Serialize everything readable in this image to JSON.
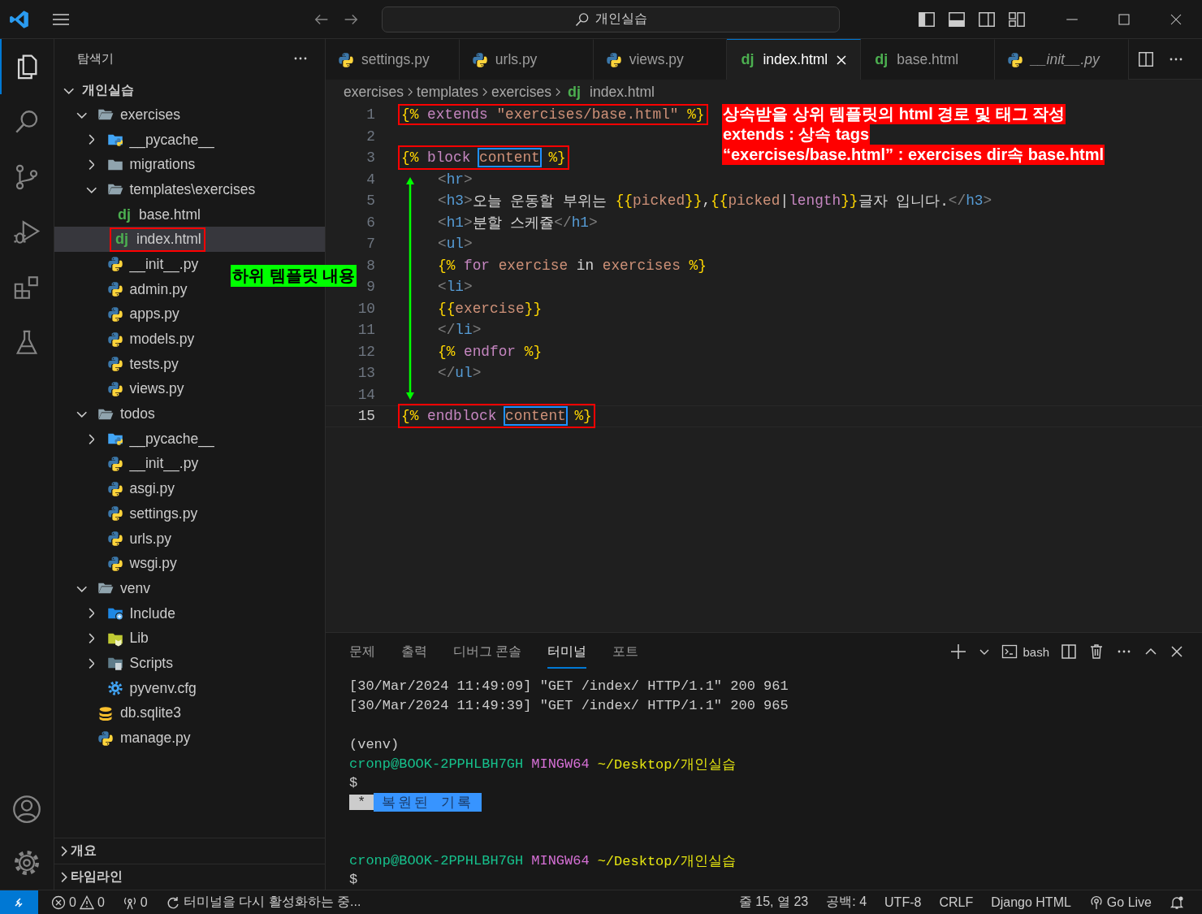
{
  "window": {
    "command_center": "개인실습"
  },
  "activity_bar": {
    "items": [
      {
        "kind": "explorer",
        "selected": true
      },
      {
        "kind": "search",
        "selected": false
      },
      {
        "kind": "source-control",
        "selected": false
      },
      {
        "kind": "run-debug",
        "selected": false
      },
      {
        "kind": "extensions",
        "selected": false
      },
      {
        "kind": "testing",
        "selected": false
      }
    ],
    "bottom": [
      {
        "kind": "account"
      },
      {
        "kind": "settings"
      }
    ]
  },
  "explorer": {
    "title": "탐색기",
    "root": {
      "label": "개인실습",
      "expanded": true,
      "children": [
        {
          "label": "exercises",
          "kind": "folder",
          "expanded": true,
          "selected": false,
          "children": [
            {
              "label": "__pycache__",
              "kind": "pycache",
              "expanded": false,
              "selected": false
            },
            {
              "label": "migrations",
              "kind": "folder",
              "expanded": false,
              "selected": false
            },
            {
              "label": "templates\\exercises",
              "kind": "folder",
              "expanded": true,
              "selected": false,
              "children": [
                {
                  "label": "base.html",
                  "kind": "django",
                  "icon_text": "dj",
                  "selected": false
                },
                {
                  "label": "index.html",
                  "kind": "django",
                  "icon_text": "dj",
                  "selected": true,
                  "boxed": true
                }
              ]
            },
            {
              "label": "__init__.py",
              "kind": "python",
              "selected": false
            },
            {
              "label": "admin.py",
              "kind": "python",
              "selected": false
            },
            {
              "label": "apps.py",
              "kind": "python",
              "selected": false
            },
            {
              "label": "models.py",
              "kind": "python",
              "selected": false
            },
            {
              "label": "tests.py",
              "kind": "python",
              "selected": false
            },
            {
              "label": "views.py",
              "kind": "python",
              "selected": false
            }
          ]
        },
        {
          "label": "todos",
          "kind": "folder",
          "expanded": true,
          "selected": false,
          "children": [
            {
              "label": "__pycache__",
              "kind": "pycache",
              "expanded": false,
              "selected": false
            },
            {
              "label": "__init__.py",
              "kind": "python",
              "selected": false
            },
            {
              "label": "asgi.py",
              "kind": "python",
              "selected": false
            },
            {
              "label": "settings.py",
              "kind": "python",
              "selected": false
            },
            {
              "label": "urls.py",
              "kind": "python",
              "selected": false
            },
            {
              "label": "wsgi.py",
              "kind": "python",
              "selected": false
            }
          ]
        },
        {
          "label": "venv",
          "kind": "folder",
          "expanded": true,
          "selected": false,
          "children": [
            {
              "label": "Include",
              "kind": "include",
              "expanded": false,
              "selected": false
            },
            {
              "label": "Lib",
              "kind": "lib",
              "expanded": false,
              "selected": false
            },
            {
              "label": "Scripts",
              "kind": "scripts",
              "expanded": false,
              "selected": false
            },
            {
              "label": "pyvenv.cfg",
              "kind": "config",
              "selected": false
            }
          ]
        },
        {
          "label": "db.sqlite3",
          "kind": "database",
          "selected": false
        },
        {
          "label": "manage.py",
          "kind": "python",
          "selected": false
        }
      ]
    },
    "sections": [
      {
        "label": "개요",
        "expanded": false
      },
      {
        "label": "타임라인",
        "expanded": false
      }
    ]
  },
  "editor": {
    "tabs": [
      {
        "label": "settings.py",
        "kind": "python",
        "selected": false,
        "preview": false
      },
      {
        "label": "urls.py",
        "kind": "python",
        "selected": false,
        "preview": false
      },
      {
        "label": "views.py",
        "kind": "python",
        "selected": false,
        "preview": false
      },
      {
        "label": "index.html",
        "kind": "django",
        "icon_text": "dj",
        "selected": true,
        "preview": false
      },
      {
        "label": "base.html",
        "kind": "django",
        "icon_text": "dj",
        "selected": false,
        "preview": false
      },
      {
        "label": "__init__.py",
        "kind": "python",
        "selected": false,
        "preview": true
      }
    ],
    "breadcrumb": [
      {
        "label": "exercises"
      },
      {
        "label": "templates"
      },
      {
        "label": "exercises"
      },
      {
        "label": "index.html",
        "icon_text": "dj"
      }
    ],
    "lines": [
      {
        "number": "1",
        "indented": false,
        "annotated": true,
        "active": false,
        "tokens": [
          {
            "text": "{%",
            "kind": "brace"
          },
          {
            "text": " extends ",
            "kind": "keyword"
          },
          {
            "text": "\"exercises/base.html\"",
            "kind": "string"
          },
          {
            "text": " %}",
            "kind": "brace"
          }
        ]
      },
      {
        "number": "2",
        "active": false
      },
      {
        "number": "3",
        "indented": false,
        "annotated": true,
        "active": false,
        "tokens": [
          {
            "text": "{%",
            "kind": "brace"
          },
          {
            "text": " block ",
            "kind": "keyword"
          },
          {
            "text": "content",
            "kind": "boxed"
          },
          {
            "text": " %}",
            "kind": "brace"
          }
        ]
      },
      {
        "number": "4",
        "indented": true,
        "annotated": false,
        "active": false,
        "tokens": [
          {
            "text": "<",
            "kind": "tag"
          },
          {
            "text": "hr",
            "kind": "tagname"
          },
          {
            "text": ">",
            "kind": "tag"
          }
        ]
      },
      {
        "number": "5",
        "indented": true,
        "annotated": false,
        "active": false,
        "tokens": [
          {
            "text": "<",
            "kind": "tag"
          },
          {
            "text": "h3",
            "kind": "tagname"
          },
          {
            "text": ">",
            "kind": "tag"
          },
          {
            "text": "오늘 운동할 부위는 ",
            "kind": "text"
          },
          {
            "text": "{{",
            "kind": "brace"
          },
          {
            "text": "picked",
            "kind": "var"
          },
          {
            "text": "}}",
            "kind": "brace"
          },
          {
            "text": ",",
            "kind": "text"
          },
          {
            "text": "{{",
            "kind": "brace"
          },
          {
            "text": "picked",
            "kind": "var"
          },
          {
            "text": "|",
            "kind": "text"
          },
          {
            "text": "length",
            "kind": "keyword"
          },
          {
            "text": "}}",
            "kind": "brace"
          },
          {
            "text": "글자 입니다.",
            "kind": "text"
          },
          {
            "text": "</",
            "kind": "tag"
          },
          {
            "text": "h3",
            "kind": "tagname"
          },
          {
            "text": ">",
            "kind": "tag"
          }
        ]
      },
      {
        "number": "6",
        "indented": true,
        "annotated": false,
        "active": false,
        "tokens": [
          {
            "text": "<",
            "kind": "tag"
          },
          {
            "text": "h1",
            "kind": "tagname"
          },
          {
            "text": ">",
            "kind": "tag"
          },
          {
            "text": "분할 스케쥴",
            "kind": "text"
          },
          {
            "text": "</",
            "kind": "tag"
          },
          {
            "text": "h1",
            "kind": "tagname"
          },
          {
            "text": ">",
            "kind": "tag"
          }
        ]
      },
      {
        "number": "7",
        "indented": true,
        "annotated": false,
        "active": false,
        "tokens": [
          {
            "text": "<",
            "kind": "tag"
          },
          {
            "text": "ul",
            "kind": "tagname"
          },
          {
            "text": ">",
            "kind": "tag"
          }
        ]
      },
      {
        "number": "8",
        "indented": true,
        "annotated": false,
        "active": false,
        "tokens": [
          {
            "text": "{%",
            "kind": "brace"
          },
          {
            "text": " for ",
            "kind": "keyword"
          },
          {
            "text": "exercise",
            "kind": "var"
          },
          {
            "text": " in ",
            "kind": "text"
          },
          {
            "text": "exercises",
            "kind": "var"
          },
          {
            "text": " %}",
            "kind": "brace"
          }
        ]
      },
      {
        "number": "9",
        "indented": true,
        "annotated": false,
        "active": false,
        "tokens": [
          {
            "text": "<",
            "kind": "tag"
          },
          {
            "text": "li",
            "kind": "tagname"
          },
          {
            "text": ">",
            "kind": "tag"
          }
        ]
      },
      {
        "number": "10",
        "indented": true,
        "annotated": false,
        "active": false,
        "tokens": [
          {
            "text": "{{",
            "kind": "brace"
          },
          {
            "text": "exercise",
            "kind": "var"
          },
          {
            "text": "}}",
            "kind": "brace"
          }
        ]
      },
      {
        "number": "11",
        "indented": true,
        "annotated": false,
        "active": false,
        "tokens": [
          {
            "text": "</",
            "kind": "tag"
          },
          {
            "text": "li",
            "kind": "tagname"
          },
          {
            "text": ">",
            "kind": "tag"
          }
        ]
      },
      {
        "number": "12",
        "indented": true,
        "annotated": false,
        "active": false,
        "tokens": [
          {
            "text": "{%",
            "kind": "brace"
          },
          {
            "text": " endfor ",
            "kind": "keyword"
          },
          {
            "text": "%}",
            "kind": "brace"
          }
        ]
      },
      {
        "number": "13",
        "indented": true,
        "annotated": false,
        "active": false,
        "tokens": [
          {
            "text": "</",
            "kind": "tag"
          },
          {
            "text": "ul",
            "kind": "tagname"
          },
          {
            "text": ">",
            "kind": "tag"
          }
        ]
      },
      {
        "number": "14",
        "active": false
      },
      {
        "number": "15",
        "indented": false,
        "annotated": true,
        "active": true,
        "tokens": [
          {
            "text": "{%",
            "kind": "brace"
          },
          {
            "text": " endblock ",
            "kind": "keyword"
          },
          {
            "text": "content",
            "kind": "boxed"
          },
          {
            "text": " %}",
            "kind": "brace"
          }
        ]
      }
    ]
  },
  "annotations": {
    "callouts": [
      "상속받을 상위 템플릿의 html 경로 및 태그 작성",
      "extends : 상속 tags",
      "“exercises/base.html” : exercises dir속 base.html"
    ],
    "label": "하위 템플릿 내용"
  },
  "panel": {
    "tabs": [
      {
        "label": "문제",
        "selected": false
      },
      {
        "label": "출력",
        "selected": false
      },
      {
        "label": "디버그 콘솔",
        "selected": false
      },
      {
        "label": "터미널",
        "selected": true
      },
      {
        "label": "포트",
        "selected": false
      }
    ],
    "shell": "bash",
    "terminal": [
      {
        "kind": "text",
        "segments": [
          {
            "text": "[30/Mar/2024 11:49:09] \"GET /index/ HTTP/1.1\" 200 961",
            "kind": "plain"
          }
        ]
      },
      {
        "kind": "text",
        "segments": [
          {
            "text": "[30/Mar/2024 11:49:39] \"GET /index/ HTTP/1.1\" 200 965",
            "kind": "plain"
          }
        ]
      },
      {
        "kind": "blank"
      },
      {
        "kind": "text",
        "segments": [
          {
            "text": "(venv)",
            "kind": "plain"
          }
        ]
      },
      {
        "kind": "text",
        "segments": [
          {
            "text": "cronp@BOOK-2PPHLBH7GH",
            "kind": "user"
          },
          {
            "text": "MINGW64",
            "kind": "system"
          },
          {
            "text": "~/Desktop/개인실습",
            "kind": "path"
          }
        ]
      },
      {
        "kind": "text",
        "segments": [
          {
            "text": "$",
            "kind": "plain"
          }
        ]
      },
      {
        "kind": "text",
        "segments": [
          {
            "text": "*",
            "kind": "mark"
          },
          {
            "text": "복원된 기록",
            "kind": "restored"
          }
        ]
      },
      {
        "kind": "blank"
      },
      {
        "kind": "blank"
      },
      {
        "kind": "text",
        "segments": [
          {
            "text": "cronp@BOOK-2PPHLBH7GH",
            "kind": "user"
          },
          {
            "text": "MINGW64",
            "kind": "system"
          },
          {
            "text": "~/Desktop/개인실습",
            "kind": "path"
          }
        ]
      },
      {
        "kind": "text",
        "segments": [
          {
            "text": "$",
            "kind": "plain"
          }
        ]
      }
    ]
  },
  "status_bar": {
    "errors": "0",
    "warnings": "0",
    "ports": "0",
    "activity": "터미널을 다시 활성화하는 중...",
    "right": [
      {
        "label": "줄 15, 열 23",
        "kind": "text"
      },
      {
        "label": "공백: 4",
        "kind": "text"
      },
      {
        "label": "UTF-8",
        "kind": "text"
      },
      {
        "label": "CRLF",
        "kind": "text"
      },
      {
        "label": "Django HTML",
        "kind": "text"
      },
      {
        "label": "Go Live",
        "kind": "golive"
      }
    ]
  }
}
